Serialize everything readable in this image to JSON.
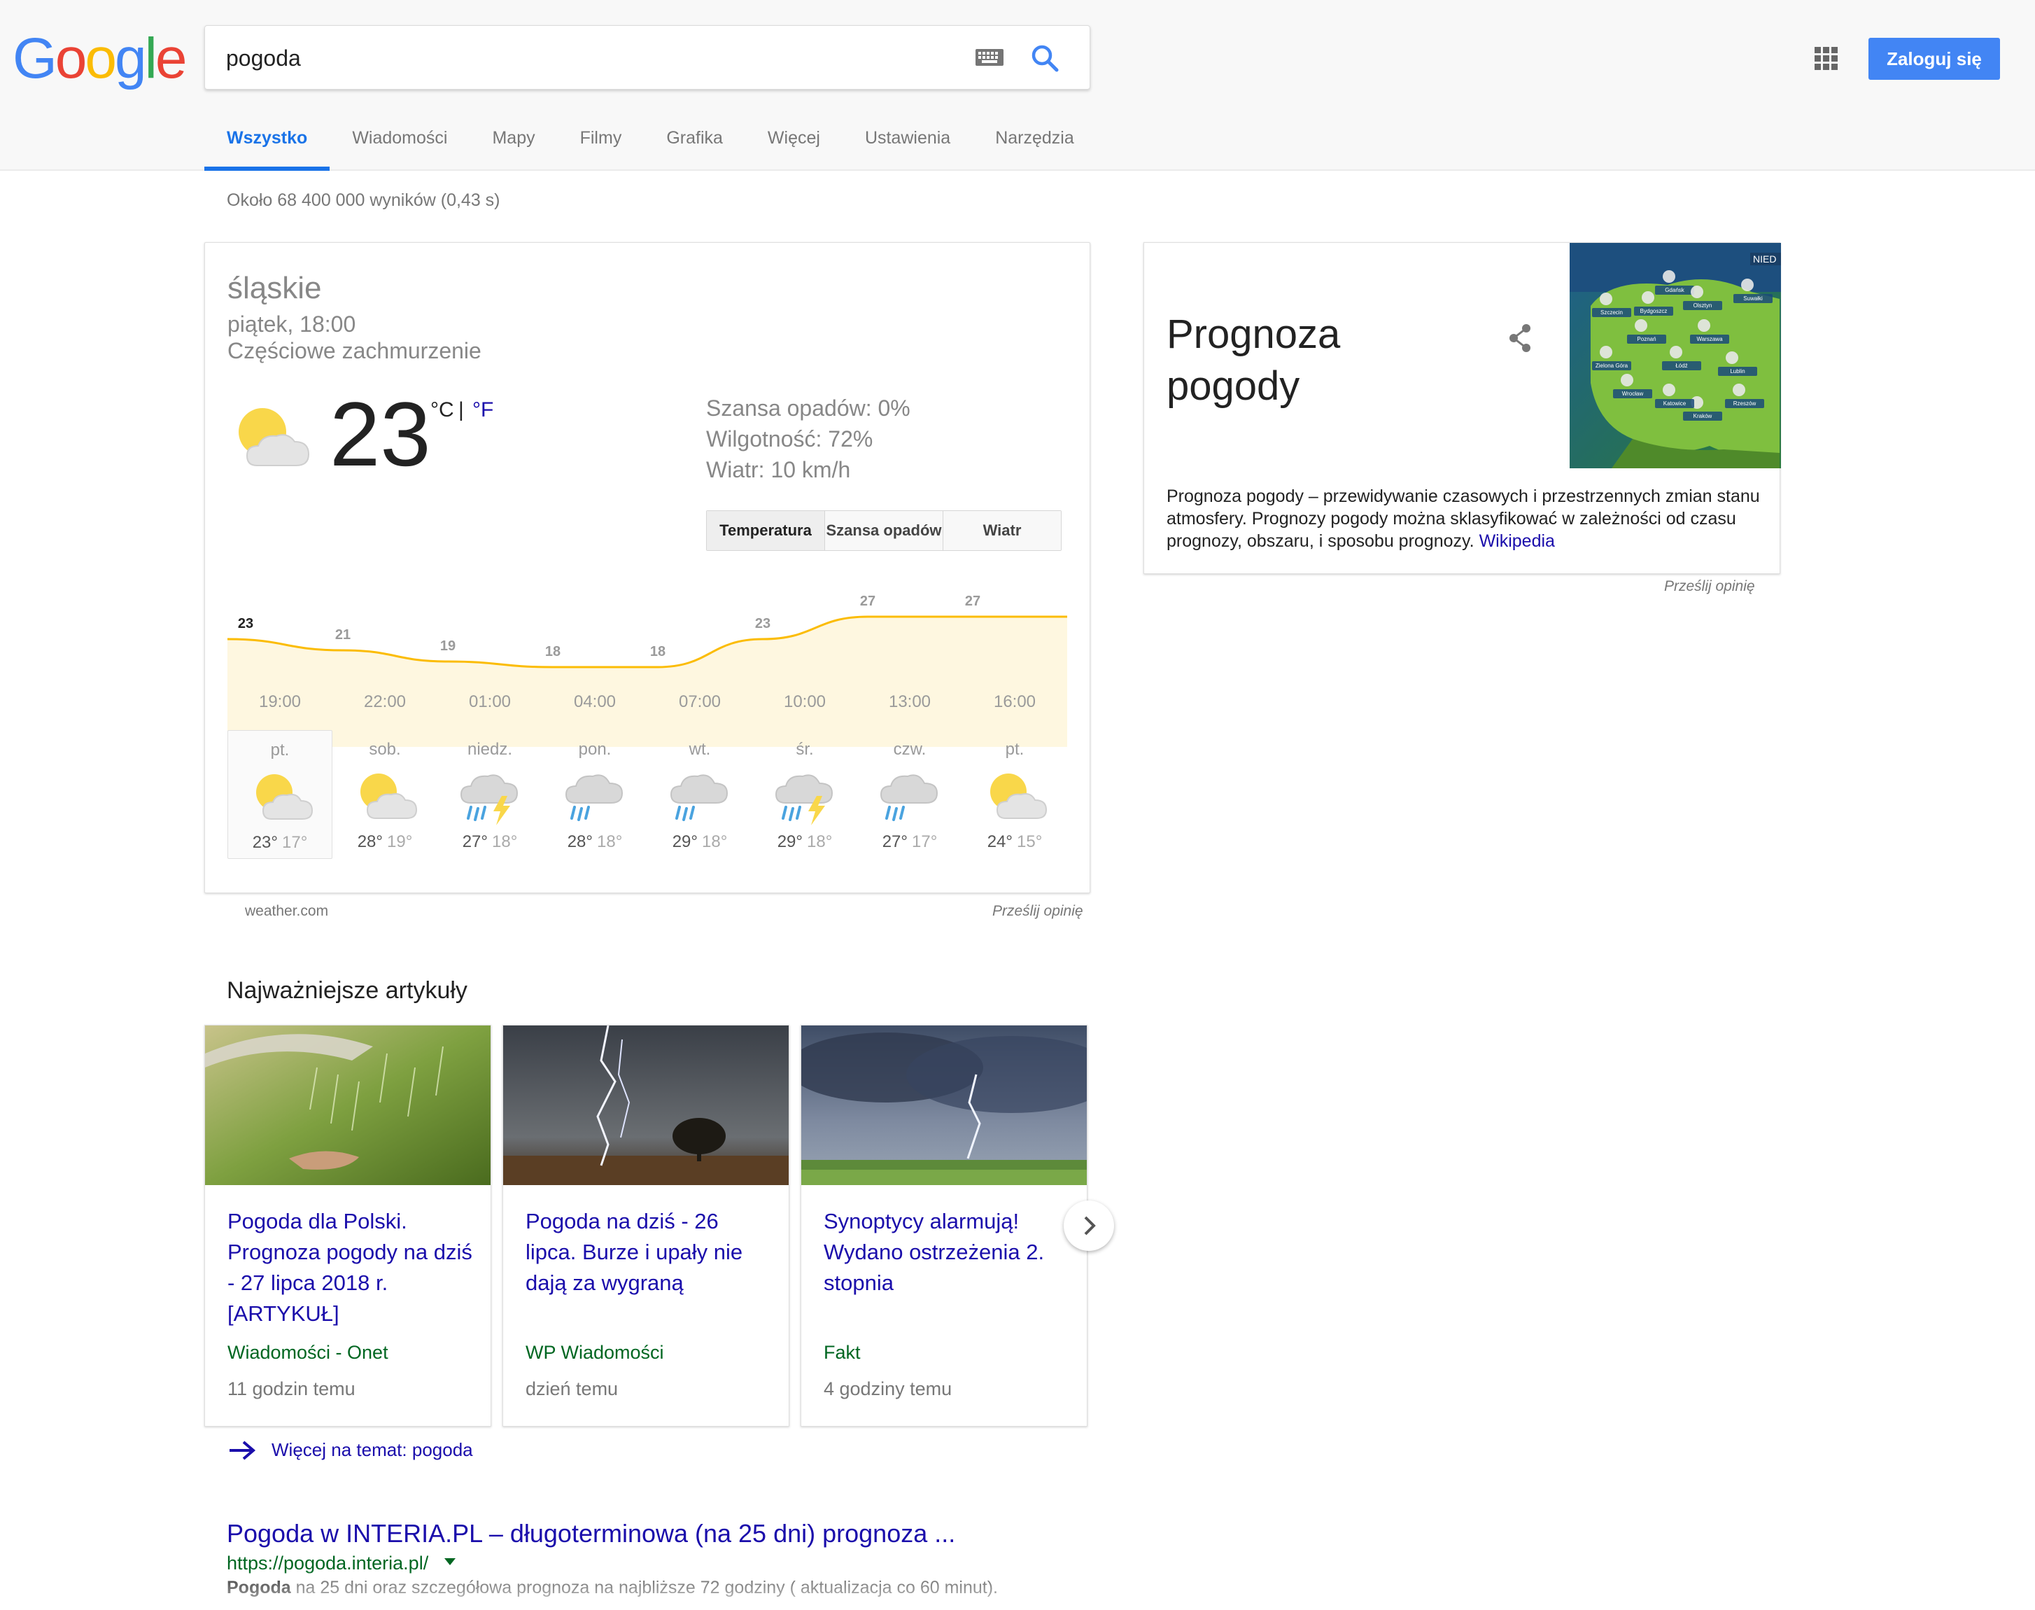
{
  "header": {
    "logo_letters": [
      "G",
      "o",
      "o",
      "g",
      "l",
      "e"
    ],
    "search_value": "pogoda",
    "signin_label": "Zaloguj się",
    "icons": {
      "keyboard": "keyboard-icon",
      "search": "search-icon",
      "apps": "apps-grid-icon"
    },
    "accent_color": "#4285f4"
  },
  "tabs": [
    {
      "label": "Wszystko",
      "active": true
    },
    {
      "label": "Wiadomości"
    },
    {
      "label": "Mapy"
    },
    {
      "label": "Filmy"
    },
    {
      "label": "Grafika"
    },
    {
      "label": "Więcej"
    },
    {
      "label": "Ustawienia"
    },
    {
      "label": "Narzędzia"
    }
  ],
  "result_stats": "Około 68 400 000 wyników (0,43 s)",
  "weather": {
    "location": "śląskie",
    "datetime": "piątek, 18:00",
    "condition": "Częściowe zachmurzenie",
    "temperature": "23",
    "unit_c": "°C",
    "unit_sep": "|",
    "unit_f": "°F",
    "precip": "Szansa opadów: 0%",
    "humidity": "Wilgotność: 72%",
    "wind": "Wiatr: 10 km/h",
    "tabs": [
      "Temperatura",
      "Szansa opadów",
      "Wiatr"
    ],
    "hourly_temps": [
      23,
      21,
      19,
      18,
      18,
      23,
      27,
      27
    ],
    "hourly_times": [
      "19:00",
      "22:00",
      "01:00",
      "04:00",
      "07:00",
      "10:00",
      "13:00",
      "16:00"
    ],
    "days": [
      {
        "name": "pt.",
        "high": "23°",
        "low": "17°",
        "icon": "partly-cloudy-icon",
        "selected": true
      },
      {
        "name": "sob.",
        "high": "28°",
        "low": "19°",
        "icon": "partly-cloudy-icon"
      },
      {
        "name": "niedz.",
        "high": "27°",
        "low": "18°",
        "icon": "thunderstorm-icon"
      },
      {
        "name": "pon.",
        "high": "28°",
        "low": "18°",
        "icon": "rain-cloud-icon"
      },
      {
        "name": "wt.",
        "high": "29°",
        "low": "18°",
        "icon": "rain-cloud-icon"
      },
      {
        "name": "śr.",
        "high": "29°",
        "low": "18°",
        "icon": "thunderstorm-icon"
      },
      {
        "name": "czw.",
        "high": "27°",
        "low": "17°",
        "icon": "rain-cloud-icon"
      },
      {
        "name": "pt.",
        "high": "24°",
        "low": "15°",
        "icon": "partly-cloudy-icon"
      }
    ],
    "source": "weather.com",
    "feedback": "Prześlij opinię"
  },
  "knowledge_panel": {
    "title": "Prognoza pogody",
    "description": "Prognoza pogody – przewidywanie czasowych i przestrzennych zmian stanu atmosfery. Prognozy pogody można sklasyfikować w zależności od czasu prognozy, obszaru, i sposobu prognozy.",
    "wiki_link": "Wikipedia",
    "feedback": "Prześlij opinię",
    "image_label": "NIED",
    "map_cities": [
      "Gdańsk",
      "Szczecin",
      "Bydgoszcz",
      "Olsztyn",
      "Suwałki",
      "Poznań",
      "Warszawa",
      "Zielona Góra",
      "Łódź",
      "Lublin",
      "Wrocław",
      "Kraków",
      "Katowice",
      "Rzeszów"
    ]
  },
  "top_stories": {
    "heading": "Najważniejsze artykuły",
    "items": [
      {
        "title": "Pogoda dla Polski. Prognoza pogody na dziś - 27 lipca 2018 r. [ARTYKUŁ]",
        "source": "Wiadomości - Onet",
        "time": "11 godzin temu"
      },
      {
        "title": "Pogoda na dziś - 26 lipca. Burze i upały nie dają za wygraną",
        "source": "WP Wiadomości",
        "time": "dzień temu"
      },
      {
        "title": "Synoptycy alarmują! Wydano ostrzeżenia 2. stopnia",
        "source": "Fakt",
        "time": "4 godziny temu"
      }
    ],
    "more_link": "Więcej na temat: pogoda"
  },
  "organic_result": {
    "title": "Pogoda w INTERIA.PL – długoterminowa (na 25 dni) prognoza ...",
    "url": "https://pogoda.interia.pl/",
    "snippet_bold": "Pogoda",
    "snippet_rest": " na 25 dni oraz szczegółowa prognoza na najbliższe 72 godziny ( aktualizacja co 60 minut)."
  }
}
